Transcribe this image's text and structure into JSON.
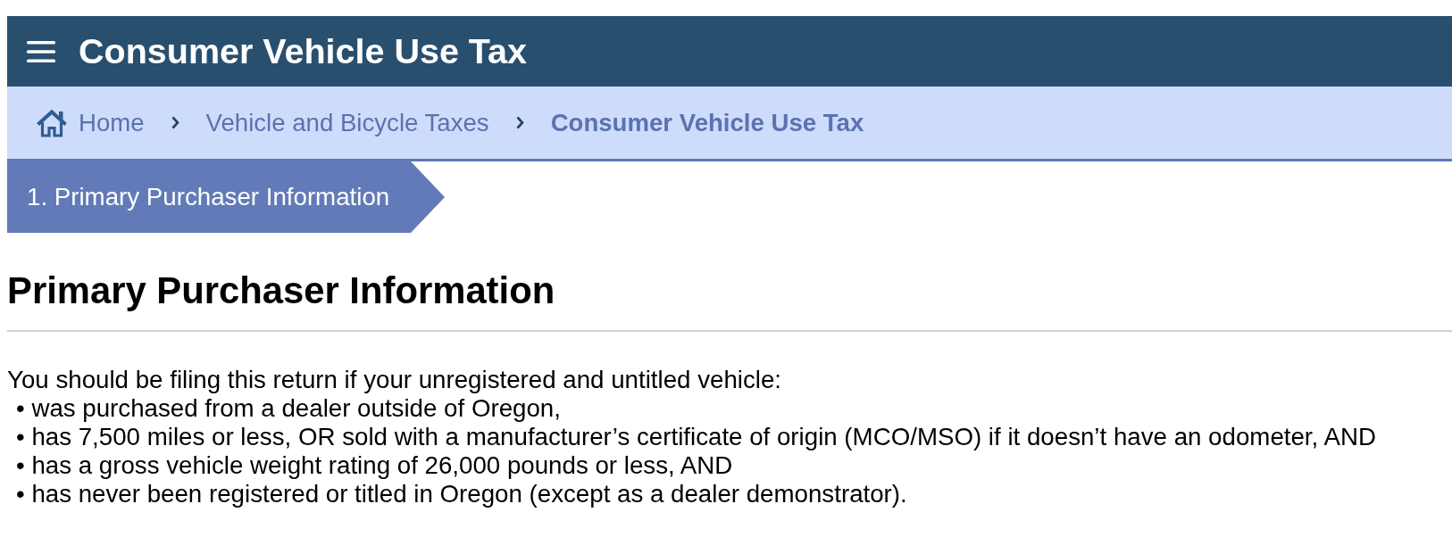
{
  "header": {
    "title": "Consumer Vehicle Use Tax"
  },
  "breadcrumb": [
    {
      "kind": "home",
      "label": "Home",
      "selected": false
    },
    {
      "kind": "link",
      "label": "Vehicle and Bicycle Taxes",
      "selected": false
    },
    {
      "kind": "link",
      "label": "Consumer Vehicle Use Tax",
      "selected": true
    }
  ],
  "steps": [
    {
      "label": "1. Primary Purchaser Information",
      "selected": true
    }
  ],
  "section": {
    "heading": "Primary Purchaser Information",
    "intro": "You should be filing this return if your unregistered and untitled vehicle:",
    "bullets": [
      "• was purchased from a dealer outside of Oregon,",
      "• has 7,500 miles or less, OR sold with a manufacturer’s certificate of origin (MCO/MSO) if it doesn’t have an odometer, AND",
      "• has a gross vehicle weight rating of 26,000 pounds or less, AND",
      "• has never been registered or titled in Oregon (except as a dealer demonstrator)."
    ]
  }
}
